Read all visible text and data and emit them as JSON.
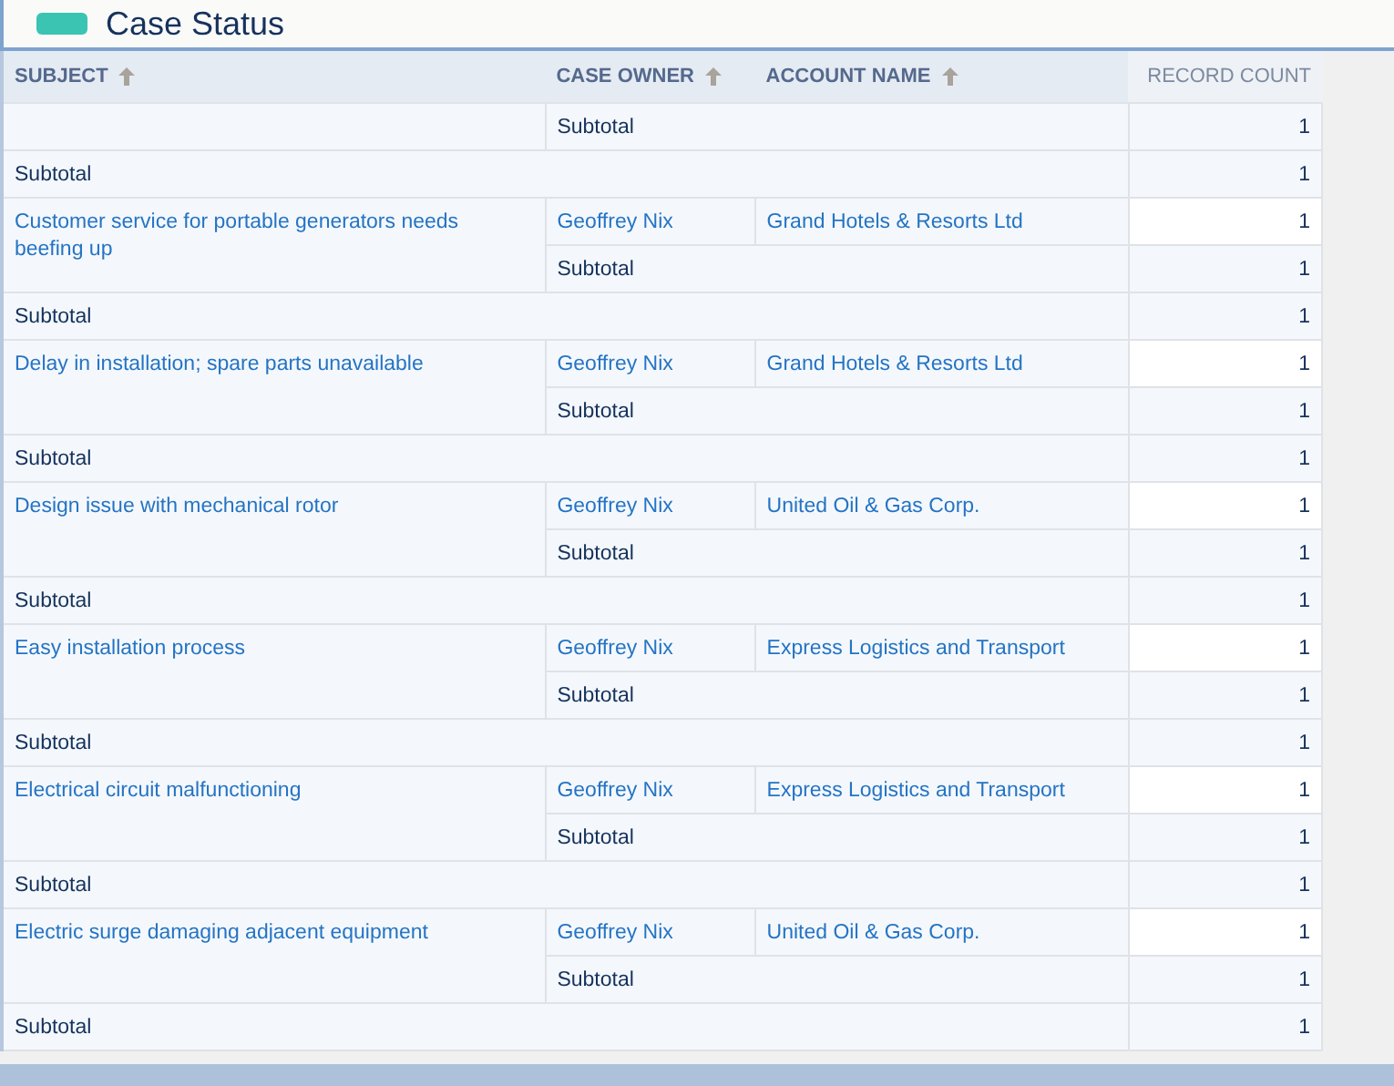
{
  "title": "Case Status",
  "columns": [
    {
      "label": "SUBJECT",
      "sort_arrow": true
    },
    {
      "label": "CASE OWNER",
      "sort_arrow": true
    },
    {
      "label": "ACCOUNT NAME",
      "sort_arrow": true
    },
    {
      "label": "RECORD COUNT",
      "sort_arrow": false
    }
  ],
  "rows": [
    {
      "kind": "owner_subtotal",
      "label": "Subtotal",
      "record_count": "1"
    },
    {
      "kind": "subject_subtotal",
      "label": "Subtotal",
      "record_count": "1"
    },
    {
      "kind": "case",
      "subject": "Customer service for portable generators needs beefing up",
      "case_owner": "Geoffrey Nix",
      "account_name": "Grand Hotels & Resorts Ltd",
      "record_count": "1"
    },
    {
      "kind": "owner_subtotal",
      "label": "Subtotal",
      "record_count": "1"
    },
    {
      "kind": "subject_subtotal",
      "label": "Subtotal",
      "record_count": "1"
    },
    {
      "kind": "case",
      "subject": "Delay in installation; spare parts unavailable",
      "case_owner": "Geoffrey Nix",
      "account_name": "Grand Hotels & Resorts Ltd",
      "record_count": "1"
    },
    {
      "kind": "owner_subtotal",
      "label": "Subtotal",
      "record_count": "1"
    },
    {
      "kind": "subject_subtotal",
      "label": "Subtotal",
      "record_count": "1"
    },
    {
      "kind": "case",
      "subject": "Design issue with mechanical rotor",
      "case_owner": "Geoffrey Nix",
      "account_name": "United Oil & Gas Corp.",
      "record_count": "1"
    },
    {
      "kind": "owner_subtotal",
      "label": "Subtotal",
      "record_count": "1"
    },
    {
      "kind": "subject_subtotal",
      "label": "Subtotal",
      "record_count": "1"
    },
    {
      "kind": "case",
      "subject": "Easy installation process",
      "case_owner": "Geoffrey Nix",
      "account_name": "Express Logistics and Transport",
      "record_count": "1"
    },
    {
      "kind": "owner_subtotal",
      "label": "Subtotal",
      "record_count": "1"
    },
    {
      "kind": "subject_subtotal",
      "label": "Subtotal",
      "record_count": "1"
    },
    {
      "kind": "case",
      "subject": "Electrical circuit malfunctioning",
      "case_owner": "Geoffrey Nix",
      "account_name": "Express Logistics and Transport",
      "record_count": "1"
    },
    {
      "kind": "owner_subtotal",
      "label": "Subtotal",
      "record_count": "1"
    },
    {
      "kind": "subject_subtotal",
      "label": "Subtotal",
      "record_count": "1"
    },
    {
      "kind": "case",
      "subject": "Electric surge damaging adjacent equipment",
      "case_owner": "Geoffrey Nix",
      "account_name": "United Oil & Gas Corp.",
      "record_count": "1"
    },
    {
      "kind": "owner_subtotal",
      "label": "Subtotal",
      "record_count": "1"
    },
    {
      "kind": "subject_subtotal",
      "label": "Subtotal",
      "record_count": "1"
    }
  ]
}
